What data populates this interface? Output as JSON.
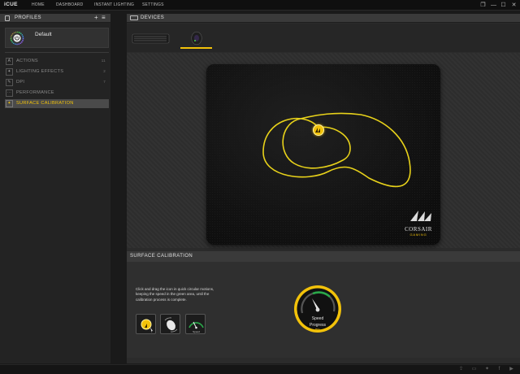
{
  "app": {
    "name": "iCUE",
    "nav": [
      "HOME",
      "DASHBOARD",
      "INSTANT LIGHTING",
      "SETTINGS"
    ],
    "window_controls": {
      "restore": "❐",
      "minimize": "—",
      "maximize": "☐",
      "close": "✕"
    }
  },
  "profiles": {
    "title": "PROFILES",
    "add_icon": "+",
    "menu_icon": "≡",
    "current": "Default"
  },
  "sidebar": {
    "items": [
      {
        "label": "ACTIONS",
        "icon": "A",
        "count": "11"
      },
      {
        "label": "LIGHTING EFFECTS",
        "icon": "✦",
        "count": "2"
      },
      {
        "label": "DPI",
        "icon": "✎",
        "count": "7"
      },
      {
        "label": "PERFORMANCE",
        "icon": "⋯",
        "count": ""
      },
      {
        "label": "SURFACE CALIBRATION",
        "icon": "✦",
        "count": "",
        "active": true
      }
    ]
  },
  "devices": {
    "title": "DEVICES",
    "list": [
      {
        "name": "keyboard",
        "selected": false
      },
      {
        "name": "mouse",
        "selected": true
      }
    ]
  },
  "mousepad": {
    "brand": "CORSAIR",
    "sub": "GAMING"
  },
  "calibration": {
    "title": "SURFACE CALIBRATION",
    "instructions": "Click and drag the icon in quick circular motions, keeping the speed in the green area, until the calibration process is complete.",
    "steps": [
      "drag-icon-step",
      "mouse-motion-step",
      "speed-gauge-step"
    ],
    "gauge": {
      "speed_label": "Speed",
      "progress_label": "Progress",
      "progress_value": "0%"
    }
  },
  "colors": {
    "accent": "#f2c20a",
    "green": "#2aa84a",
    "panel": "#2b2b2b"
  }
}
